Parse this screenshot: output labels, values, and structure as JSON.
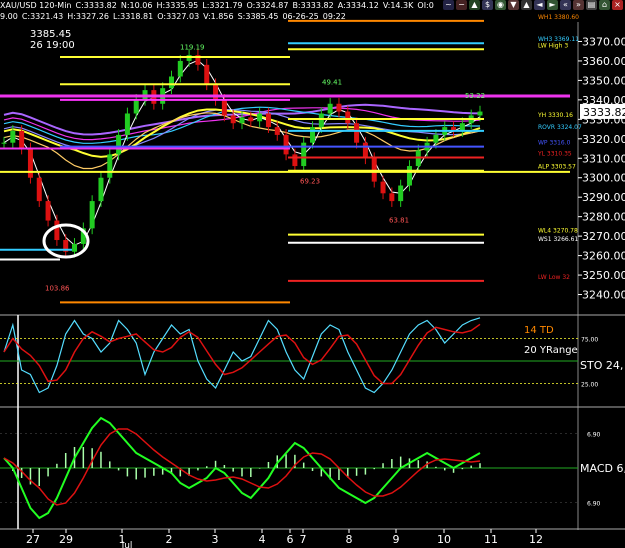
{
  "header": {
    "line1": [
      "XAU/USD 120-Min",
      "C:3333.82",
      "N:10.06",
      "H:3335.95",
      "L:3321.79",
      "O:3324.87",
      "B:3333.82",
      "A:3334.12",
      "V:14.3K",
      "OI:0"
    ],
    "line2": [
      "9.00",
      "C:3321.43",
      "H:3327.26",
      "L:3318.81",
      "O:3327.03",
      "V:1.856",
      "S:3385.45",
      "06-26-25",
      "09:22"
    ]
  },
  "toolbar_icons": [
    "tilde-icon",
    "minus-icon",
    "chart-icon",
    "dollar-icon",
    "globe-icon",
    "arrow-down-icon",
    "arrow-up-icon",
    "arrow-left-icon",
    "arrow-right-icon",
    "back-icon",
    "forward-icon",
    "print-icon",
    "home-icon",
    "close-icon"
  ],
  "colors": {
    "up": "#22cc22",
    "down": "#dd1111",
    "cyan": "#33ccff",
    "yellow": "#ffff33",
    "magenta": "#ee33ee",
    "orange": "#ff8800",
    "red": "#ee2222",
    "blue": "#4455ff",
    "purple": "#aa66ff",
    "white": "#ffffff",
    "green": "#22dd22"
  },
  "tooltip": {
    "price": "3385.45",
    "time": "26 19:00"
  },
  "current_price": "3333.82",
  "chart_data": [
    {
      "type": "line",
      "panel": "price",
      "y_ticks": [
        3370,
        3360,
        3350,
        3340,
        3330,
        3320,
        3310,
        3300,
        3290,
        3280,
        3270,
        3260,
        3250,
        3240
      ],
      "ylim": [
        3230,
        3380
      ],
      "x_tick_labels": [
        "27",
        "29",
        "1",
        "2",
        "3",
        "4",
        "6",
        "7",
        "8",
        "9",
        "10",
        "11",
        "12"
      ],
      "x_sub_label": "Jul",
      "candles_close_path": [
        3318,
        3324,
        3315,
        3300,
        3288,
        3278,
        3268,
        3262,
        3266,
        3274,
        3288,
        3300,
        3312,
        3322,
        3333,
        3340,
        3345,
        3338,
        3346,
        3352,
        3360,
        3363,
        3358,
        3348,
        3340,
        3332,
        3328,
        3331,
        3329,
        3333,
        3326,
        3322,
        3312,
        3306,
        3318,
        3326,
        3333,
        3338,
        3334,
        3328,
        3318,
        3310,
        3298,
        3292,
        3288,
        3296,
        3306,
        3314,
        3318,
        3322,
        3326,
        3324,
        3328,
        3332,
        3334
      ],
      "annotations": [
        {
          "text": "119.19",
          "value": 3366
        },
        {
          "text": "49.41",
          "value": 3348
        },
        {
          "text": "53.22",
          "value": 3341
        },
        {
          "text": "69.23",
          "value": 3297
        },
        {
          "text": "63.81",
          "value": 3277
        },
        {
          "text": "103.86",
          "value": 3242
        }
      ],
      "levels": [
        {
          "label": "WH1 3380.60",
          "value": 3380.6,
          "color": "orange"
        },
        {
          "label": "WH3 3369.11",
          "value": 3369.1,
          "color": "cyan"
        },
        {
          "label": "LW High 3",
          "value": 3366,
          "color": "yellow"
        },
        {
          "label": "YH 3330.16",
          "value": 3330.2,
          "color": "yellow"
        },
        {
          "label": "ROVR 3324.07",
          "value": 3324.1,
          "color": "cyan"
        },
        {
          "label": "WP 3316.0",
          "value": 3316.0,
          "color": "blue"
        },
        {
          "label": "YL 3310.35",
          "value": 3310.4,
          "color": "red"
        },
        {
          "label": "ALP 3303.57",
          "value": 3303.6,
          "color": "yellow"
        },
        {
          "label": "WL4 3270.78",
          "value": 3270.8,
          "color": "yellow"
        },
        {
          "label": "WS1 3266.61",
          "value": 3266.6,
          "color": "white"
        },
        {
          "label": "LW Low 32",
          "value": 3247,
          "color": "red"
        }
      ]
    },
    {
      "type": "line",
      "panel": "stochastic",
      "name": "STO",
      "y_ticks": [
        75,
        25
      ],
      "ylim": [
        0,
        100
      ],
      "labels": {
        "td": "14 TD",
        "range": "20 YRange",
        "sto": "STO 24,"
      }
    },
    {
      "type": "line",
      "panel": "macd",
      "name": "MACD",
      "y_ticks": [
        6.9,
        -6.9
      ],
      "ylim": [
        -12,
        12
      ],
      "labels": {
        "macd": "MACD 6,",
        "upper": "6.90",
        "lower": "6.90"
      }
    }
  ]
}
